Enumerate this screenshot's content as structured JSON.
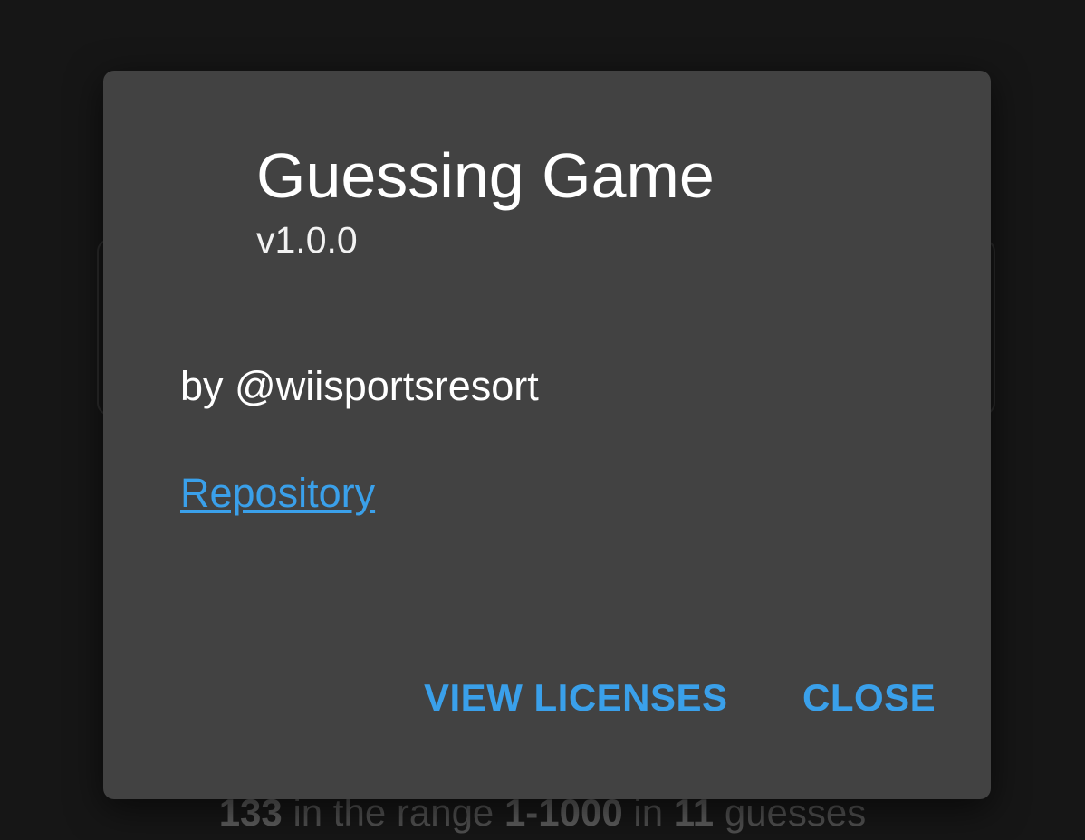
{
  "dialog": {
    "title": "Guessing Game",
    "version": "v1.0.0",
    "author": "by @wiisportsresort",
    "repository_link": "Repository",
    "buttons": {
      "view_licenses": "VIEW LICENSES",
      "close": "CLOSE"
    }
  },
  "background": {
    "result": {
      "number": "133",
      "text_1": " in the range ",
      "range": "1-1000",
      "text_2": " in ",
      "guesses": "11",
      "text_3": " guesses"
    }
  },
  "colors": {
    "accent": "#3aa0ea",
    "dialog_bg": "#424242",
    "page_bg": "#161616"
  }
}
